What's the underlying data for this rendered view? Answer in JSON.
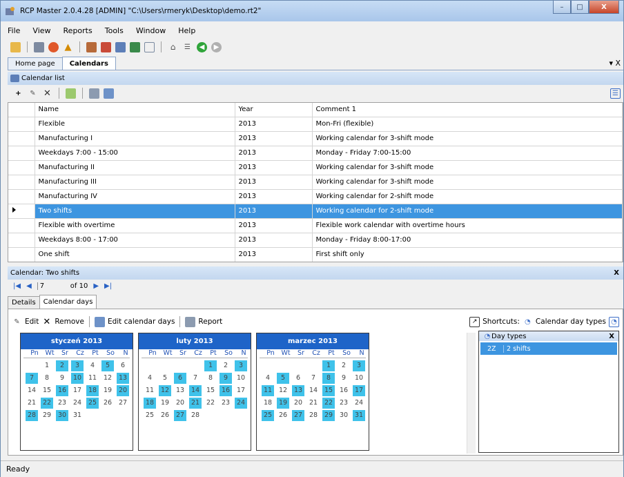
{
  "window": {
    "title": "RCP Master 2.0.4.28  [ADMIN] \"C:\\Users\\rmeryk\\Desktop\\demo.rt2\"",
    "min": "–",
    "max": "□",
    "close": "X"
  },
  "menu": [
    "File",
    "View",
    "Reports",
    "Tools",
    "Window",
    "Help"
  ],
  "tabs": [
    "Home page",
    "Calendars"
  ],
  "pin": "▾ X",
  "calendar_list": {
    "header": "Calendar list",
    "columns": [
      "Name",
      "Year",
      "Comment 1"
    ],
    "rows": [
      [
        "Flexible",
        "2013",
        "Mon-Fri (flexible)"
      ],
      [
        "Manufacturing I",
        "2013",
        "Working calendar for 3-shift mode"
      ],
      [
        "Weekdays 7:00 - 15:00",
        "2013",
        "Monday - Friday 7:00-15:00"
      ],
      [
        "Manufacturing II",
        "2013",
        "Working calendar for 3-shift mode"
      ],
      [
        "Manufacturing III",
        "2013",
        "Working calendar for 3-shift mode"
      ],
      [
        "Manufacturing IV",
        "2013",
        "Working calendar for 2-shift mode"
      ],
      [
        "Two shifts",
        "2013",
        "Working calendar for 2-shift mode"
      ],
      [
        "Flexible with overtime",
        "2013",
        "Flexible work calendar with overtime hours"
      ],
      [
        "Weekdays 8:00 - 17:00",
        "2013",
        "Monday - Friday 8:00-17:00"
      ],
      [
        "One shift",
        "2013",
        "First shift only"
      ]
    ],
    "selected_index": 6
  },
  "detail": {
    "header": "Calendar: Two shifts",
    "close": "X",
    "record": "7",
    "of": "of 10"
  },
  "detail_tabs": [
    "Details",
    "Calendar days"
  ],
  "detail_toolbar": {
    "edit": "Edit",
    "remove": "Remove",
    "edit_days": "Edit calendar days",
    "report": "Report",
    "shortcuts": "Shortcuts:",
    "day_types": "Calendar day types"
  },
  "weekdays": [
    "Pn",
    "Wt",
    "Śr",
    "Cz",
    "Pt",
    "So",
    "N"
  ],
  "months": [
    {
      "name": "styczeń 2013",
      "offset": 1,
      "days": 31,
      "marked": [
        2,
        3,
        5,
        7,
        10,
        13,
        16,
        18,
        20,
        22,
        25,
        28,
        30
      ]
    },
    {
      "name": "luty 2013",
      "offset": 4,
      "days": 28,
      "marked": [
        1,
        3,
        6,
        9,
        12,
        14,
        16,
        18,
        21,
        24,
        27
      ]
    },
    {
      "name": "marzec 2013",
      "offset": 4,
      "days": 31,
      "marked": [
        1,
        3,
        5,
        8,
        11,
        13,
        15,
        17,
        19,
        22,
        25,
        27,
        29,
        31
      ]
    }
  ],
  "day_types": {
    "title": "Day types",
    "close": "X",
    "rows": [
      [
        "2Z",
        "2 shifts"
      ]
    ]
  },
  "status": "Ready"
}
